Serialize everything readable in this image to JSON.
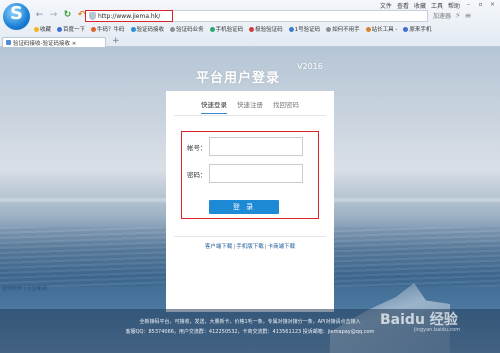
{
  "browser": {
    "menu": [
      "文件",
      "查看",
      "收藏",
      "工具",
      "帮助"
    ],
    "address_url": "http://www.jiema.hk/",
    "right_tools": [
      "加速器",
      "⚡",
      "≡"
    ],
    "bookmarks": [
      "收藏",
      "百度一下",
      "牛码？牛码",
      "验证码接收",
      "验证码业务",
      "手机验证码",
      "极验验证码",
      "1号验证码",
      "如何不用手",
      "站长工具 -",
      "原来手机"
    ],
    "tab_title": "验证码接收-验证码接收 ×",
    "new_tab": "+"
  },
  "page": {
    "title": "平台用户登录",
    "title_version": "V2016",
    "tabs": [
      "快速登录",
      "快速注册",
      "找回密码"
    ],
    "active_tab": "快速登录",
    "account_label": "帐号：",
    "account_value": "",
    "password_label": "密码：",
    "password_value": "",
    "login_button": "登 录",
    "downloads": [
      "客户端下载",
      "手机版下载",
      "卡商端下载"
    ],
    "corner_links": "合作伙伴 | 行业新闻",
    "footer_line1": "全新接码平台，可接收，发送，大量新卡，价格1毛一条，专属对接对接分一条，API对接请点击接入",
    "footer_line2": "客服QQ：85374066，用户交流群：412250532，卡商交流群：413561123 投诉邮箱：jiemapay@qq.com",
    "watermark": "Baidu 经验",
    "watermark_sub": "jingyan.baidu.com"
  }
}
